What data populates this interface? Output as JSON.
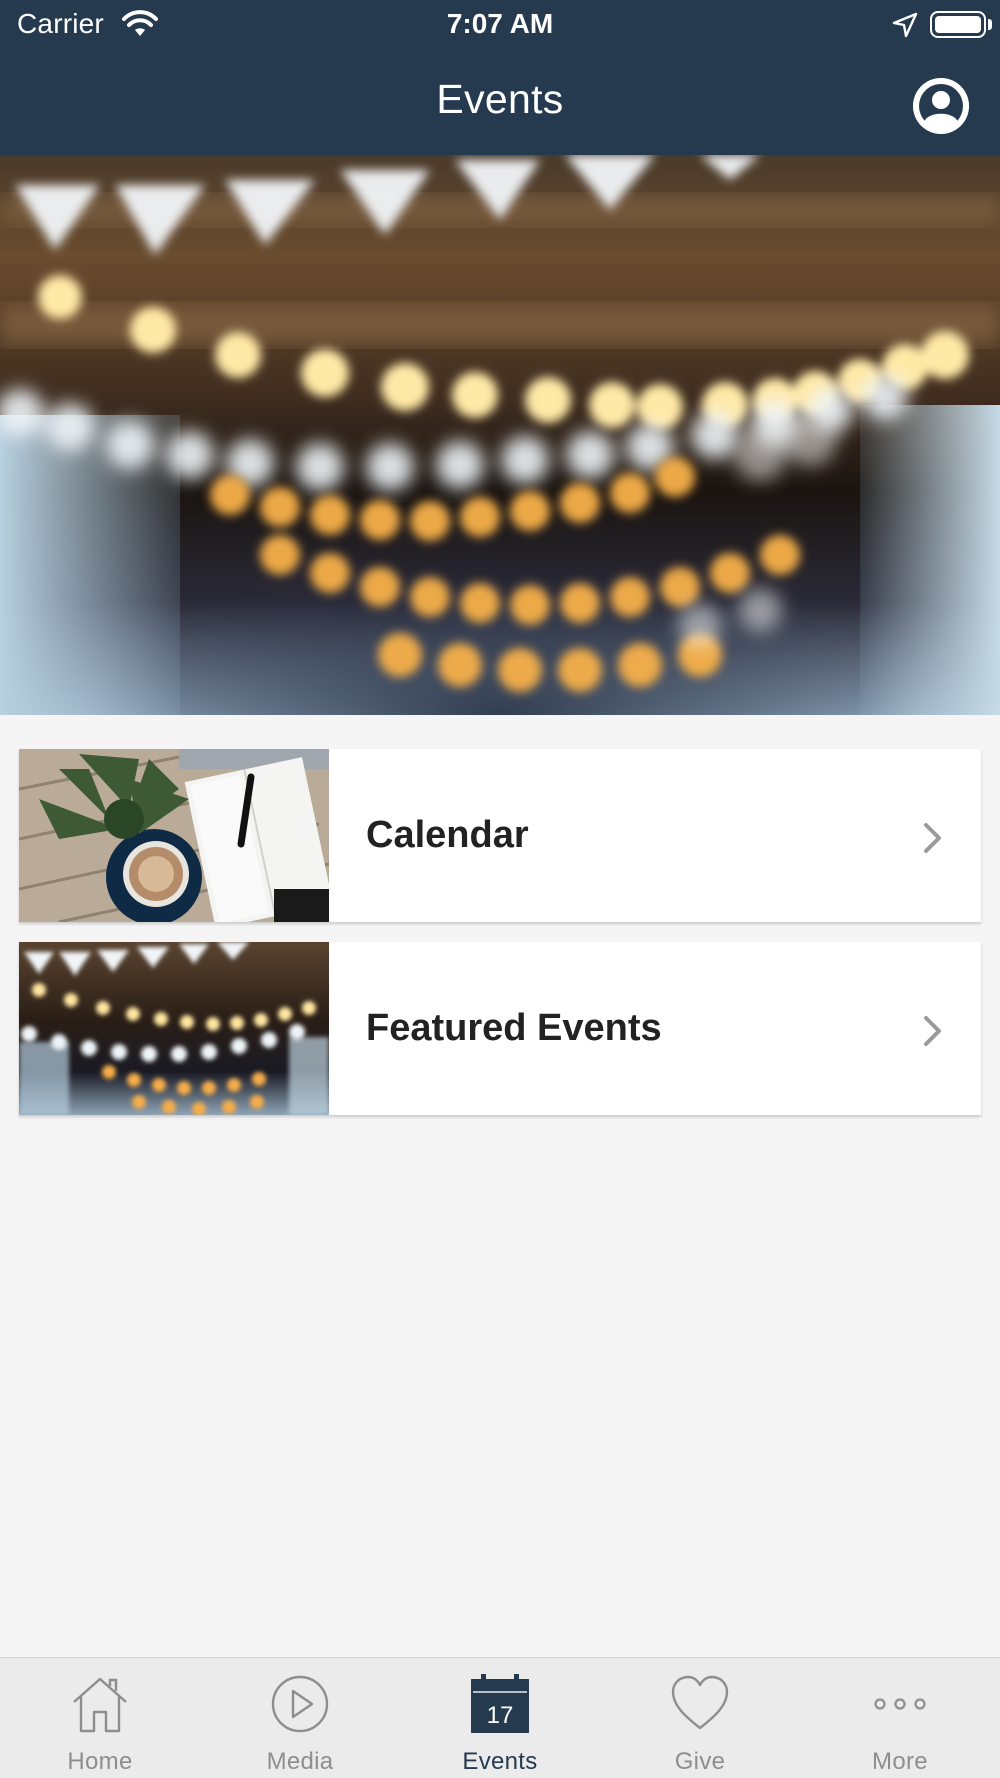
{
  "status_bar": {
    "carrier": "Carrier",
    "time": "7:07 AM"
  },
  "nav": {
    "title": "Events",
    "profile_icon": "user-circle-icon"
  },
  "hero": {
    "image": "string-lights-bokeh-photo"
  },
  "cards": [
    {
      "label": "Calendar",
      "thumbnail": "coffee-notebook-photo",
      "icon": "chevron-right-icon"
    },
    {
      "label": "Featured Events",
      "thumbnail": "string-lights-photo",
      "icon": "chevron-right-icon"
    }
  ],
  "tabbar": {
    "tabs": [
      {
        "label": "Home",
        "icon": "house-icon",
        "active": false
      },
      {
        "label": "Media",
        "icon": "play-circle-icon",
        "active": false
      },
      {
        "label": "Events",
        "icon": "calendar-icon",
        "active": true,
        "calendar_day": "17"
      },
      {
        "label": "Give",
        "icon": "heart-icon",
        "active": false
      },
      {
        "label": "More",
        "icon": "more-dots-icon",
        "active": false
      }
    ]
  },
  "colors": {
    "nav_background": "#263a4f",
    "page_background": "#f5f5f5",
    "tab_active": "#263a4f",
    "tab_inactive": "#8e8e8e"
  }
}
